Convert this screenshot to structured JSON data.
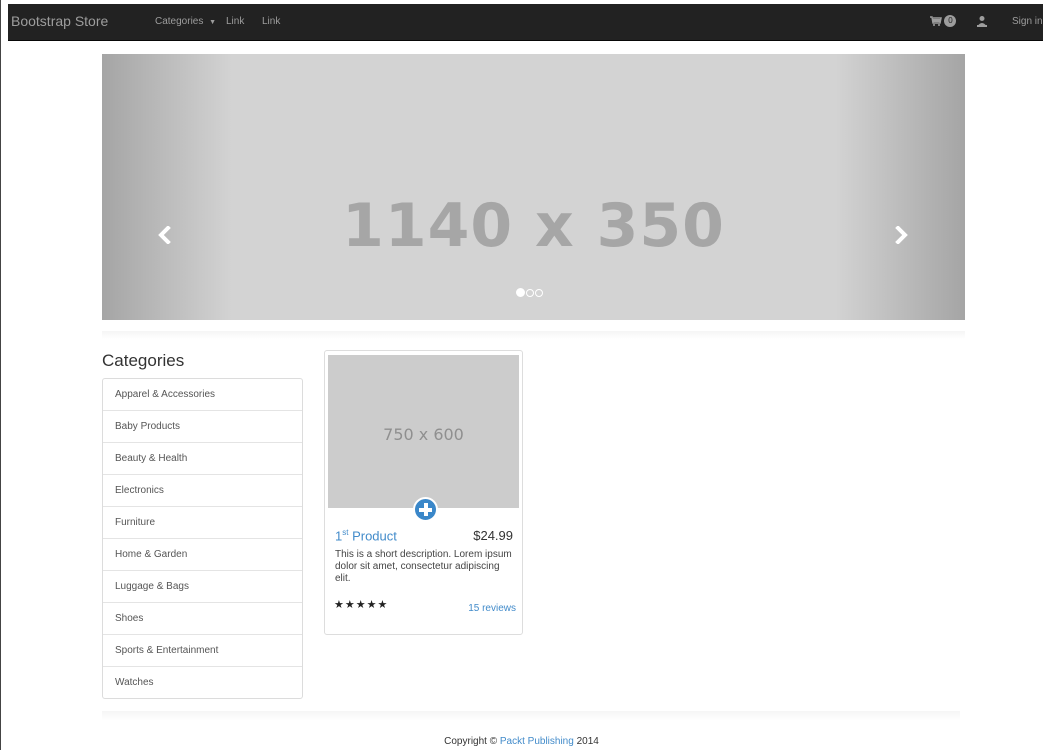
{
  "navbar": {
    "brand": "Bootstrap Store",
    "links": [
      {
        "label": "Categories"
      },
      {
        "label": "Link"
      },
      {
        "label": "Link"
      }
    ],
    "cart_icon": "shopping-cart-icon",
    "cart_count": "0",
    "user_icon": "user-icon",
    "sign_in": "Sign in"
  },
  "carousel": {
    "caption": "1140 x 350",
    "slides_total": 3,
    "active_index": 0,
    "prev_icon": "chevron-left-icon",
    "next_icon": "chevron-right-icon"
  },
  "sidebar": {
    "heading": "Categories",
    "items": [
      {
        "label": "Apparel & Accessories"
      },
      {
        "label": "Baby Products"
      },
      {
        "label": "Beauty & Health"
      },
      {
        "label": "Electronics"
      },
      {
        "label": "Furniture"
      },
      {
        "label": "Home & Garden"
      },
      {
        "label": "Luggage & Bags"
      },
      {
        "label": "Shoes"
      },
      {
        "label": "Sports & Entertainment"
      },
      {
        "label": "Watches"
      }
    ]
  },
  "product": {
    "image_caption": "750 x 600",
    "name_prefix": "1",
    "name_sup": "st",
    "name_suffix": " Product",
    "price": "$24.99",
    "description": "This is a short description. Lorem ipsum dolor sit amet, consectetur adipiscing elit.",
    "rating": 5,
    "stars": "★★★★★",
    "reviews": "15 reviews",
    "add_icon": "plus-circle-icon"
  },
  "footer": {
    "prefix": "Copyright © ",
    "link": "Packt Publishing",
    "suffix": " 2014"
  },
  "colors": {
    "navbar_bg": "#222222",
    "link": "#428bca",
    "carousel_bg": "#d3d3d3"
  }
}
